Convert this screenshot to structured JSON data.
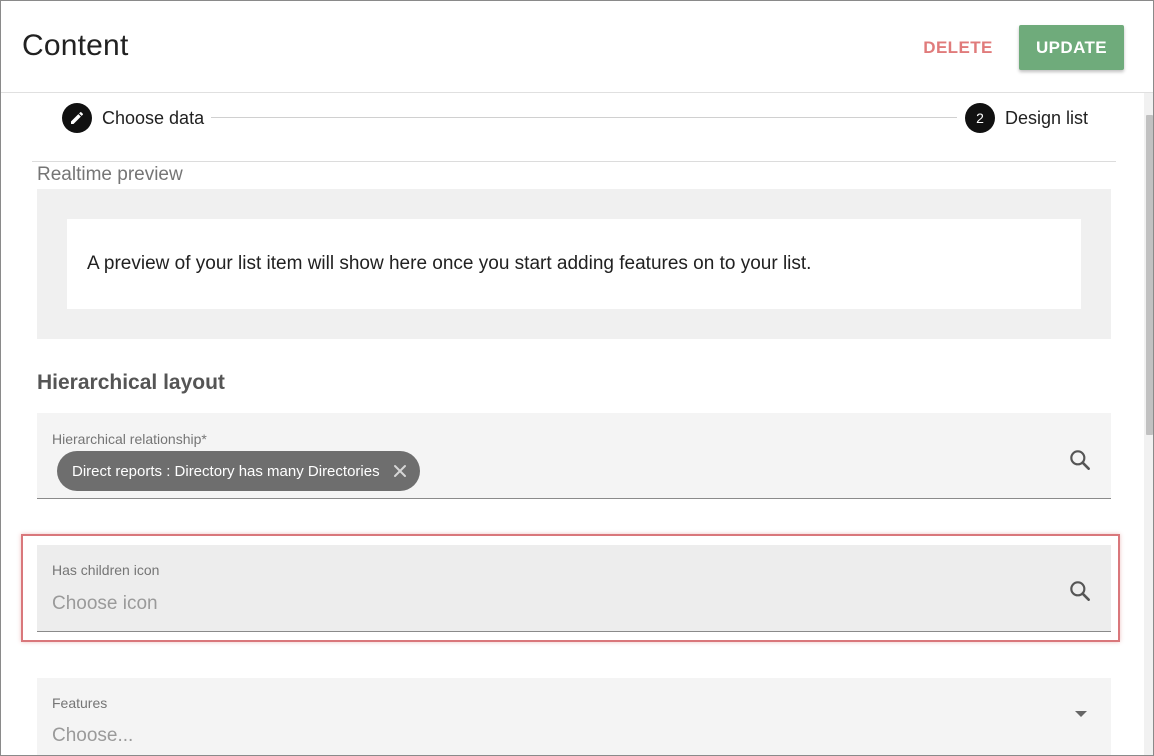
{
  "header": {
    "title": "Content",
    "delete_label": "DELETE",
    "update_label": "UPDATE"
  },
  "stepper": {
    "steps": [
      {
        "label": "Choose data",
        "icon": "pencil-icon"
      },
      {
        "label": "Design list",
        "number": "2"
      }
    ]
  },
  "preview": {
    "section_label": "Realtime preview",
    "message": "A preview of your list item will show here once you start adding features on to your list."
  },
  "hierarchical": {
    "heading": "Hierarchical layout",
    "relationship_label": "Hierarchical relationship*",
    "relationship_chip": "Direct reports : Directory has many Directories",
    "children_icon_label": "Has children icon",
    "children_icon_placeholder": "Choose icon",
    "features_label": "Features",
    "features_placeholder": "Choose..."
  },
  "colors": {
    "delete": "#e07b7b",
    "update": "#6fab7b",
    "highlight": "#d9777b",
    "chip": "#6e6e6e"
  }
}
